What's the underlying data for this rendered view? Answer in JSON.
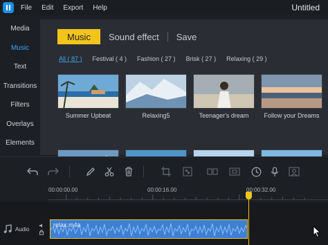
{
  "app": {
    "title": "Untitled",
    "menu": [
      "File",
      "Edit",
      "Export",
      "Help"
    ]
  },
  "sidebar": {
    "items": [
      {
        "label": "Media",
        "active": false
      },
      {
        "label": "Music",
        "active": true
      },
      {
        "label": "Text",
        "active": false
      },
      {
        "label": "Transitions",
        "active": false
      },
      {
        "label": "Filters",
        "active": false
      },
      {
        "label": "Overlays",
        "active": false
      },
      {
        "label": "Elements",
        "active": false
      }
    ]
  },
  "library": {
    "tabs": [
      {
        "label": "Music",
        "active": true
      },
      {
        "label": "Sound effect",
        "active": false
      },
      {
        "label": "Save",
        "active": false
      }
    ],
    "filters": [
      {
        "label": "All ( 87 )",
        "active": true
      },
      {
        "label": "Festival ( 4 )",
        "active": false
      },
      {
        "label": "Fashion ( 27 )",
        "active": false
      },
      {
        "label": "Brisk ( 27 )",
        "active": false
      },
      {
        "label": "Relaxing ( 29 )",
        "active": false
      }
    ],
    "items": [
      {
        "label": "Summer Upbeat",
        "theme": "beach"
      },
      {
        "label": "Relaxing5",
        "theme": "mountain-snow"
      },
      {
        "label": "Teenager's dream",
        "theme": "girl-beach"
      },
      {
        "label": "Follow your Dreams",
        "theme": "sunset-sea"
      },
      {
        "label": "",
        "theme": "mountain-blue"
      },
      {
        "label": "",
        "theme": "swimmer"
      },
      {
        "label": "",
        "theme": "island"
      },
      {
        "label": "",
        "theme": "ocean"
      }
    ]
  },
  "toolbar": {
    "tools": [
      "undo-icon",
      "redo-icon",
      "edit-icon",
      "cut-icon",
      "delete-icon",
      "crop-icon",
      "mosaic-icon",
      "speed-icon",
      "split-screen-icon",
      "duration-icon",
      "record-icon",
      "camera-icon"
    ]
  },
  "timeline": {
    "ticks": [
      "00:00:00.00",
      "00:00:16.00",
      "00:00:32.00"
    ],
    "track_label": "Audio",
    "clip_name": "relax.m4a",
    "accent": "#f3c51b"
  },
  "colors": {
    "accent_yellow": "#f3c51b",
    "accent_blue": "#3fa6ee",
    "clip_blue": "#3d7fd3"
  }
}
